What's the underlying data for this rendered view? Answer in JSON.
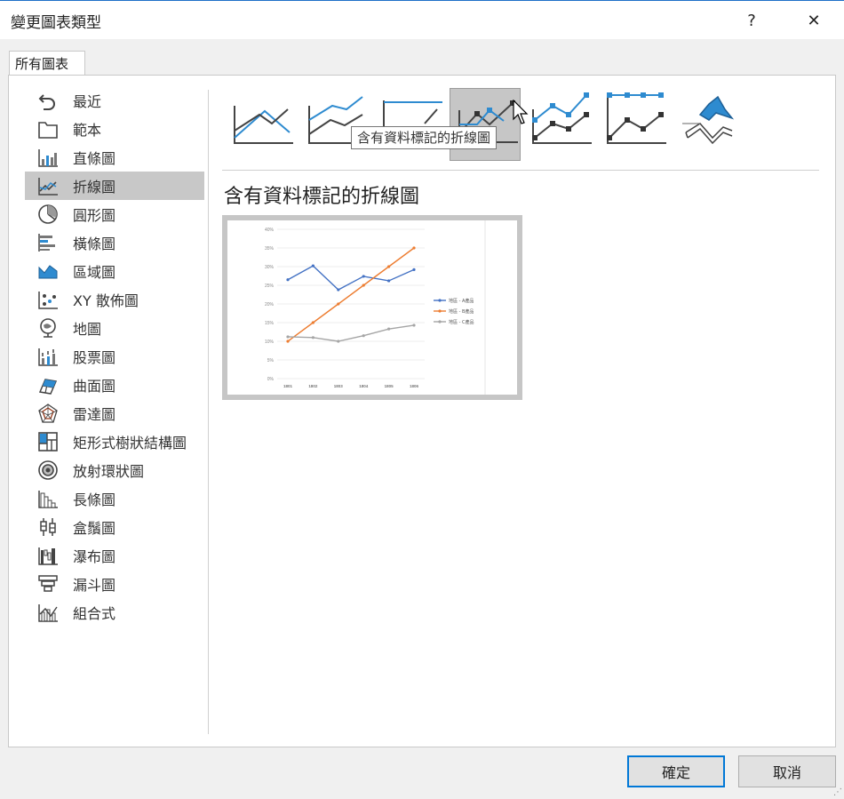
{
  "window": {
    "title": "變更圖表類型",
    "help": "?",
    "close": "✕"
  },
  "tabs": [
    {
      "label": "所有圖表"
    }
  ],
  "sidebar": {
    "items": [
      {
        "label": "最近",
        "icon": "undo-icon"
      },
      {
        "label": "範本",
        "icon": "folder-icon"
      },
      {
        "label": "直條圖",
        "icon": "column-chart-icon"
      },
      {
        "label": "折線圖",
        "icon": "line-chart-icon",
        "selected": true
      },
      {
        "label": "圓形圖",
        "icon": "pie-chart-icon"
      },
      {
        "label": "橫條圖",
        "icon": "bar-chart-icon"
      },
      {
        "label": "區域圖",
        "icon": "area-chart-icon"
      },
      {
        "label": "XY 散佈圖",
        "icon": "scatter-chart-icon"
      },
      {
        "label": "地圖",
        "icon": "globe-icon"
      },
      {
        "label": "股票圖",
        "icon": "stock-chart-icon"
      },
      {
        "label": "曲面圖",
        "icon": "surface-chart-icon"
      },
      {
        "label": "雷達圖",
        "icon": "radar-chart-icon"
      },
      {
        "label": "矩形式樹狀結構圖",
        "icon": "treemap-icon"
      },
      {
        "label": "放射環狀圖",
        "icon": "sunburst-icon"
      },
      {
        "label": "長條圖",
        "icon": "histogram-icon"
      },
      {
        "label": "盒鬚圖",
        "icon": "box-whisker-icon"
      },
      {
        "label": "瀑布圖",
        "icon": "waterfall-icon"
      },
      {
        "label": "漏斗圖",
        "icon": "funnel-icon"
      },
      {
        "label": "組合式",
        "icon": "combo-chart-icon"
      }
    ]
  },
  "subtypes": {
    "selected_index": 3,
    "tooltip": "含有資料標記的折線圖"
  },
  "preview": {
    "heading": "含有資料標記的折線圖"
  },
  "chart_data": {
    "type": "line",
    "categories": [
      "1801",
      "1802",
      "1803",
      "1804",
      "1805",
      "1806"
    ],
    "ylim": [
      0,
      0.4
    ],
    "yticks": [
      "0%",
      "5%",
      "10%",
      "15%",
      "20%",
      "25%",
      "30%",
      "35%",
      "40%"
    ],
    "series": [
      {
        "name": "地區 - A產品",
        "color": "#4472c4",
        "values": [
          0.265,
          0.302,
          0.238,
          0.274,
          0.262,
          0.292
        ]
      },
      {
        "name": "地區 - B產品",
        "color": "#ed7d31",
        "values": [
          0.1,
          0.15,
          0.2,
          0.25,
          0.3,
          0.35
        ]
      },
      {
        "name": "地區 - C產品",
        "color": "#a5a5a5",
        "values": [
          0.112,
          0.11,
          0.1,
          0.115,
          0.133,
          0.143
        ]
      }
    ],
    "legend": "right"
  },
  "buttons": {
    "ok": "確定",
    "cancel": "取消"
  }
}
